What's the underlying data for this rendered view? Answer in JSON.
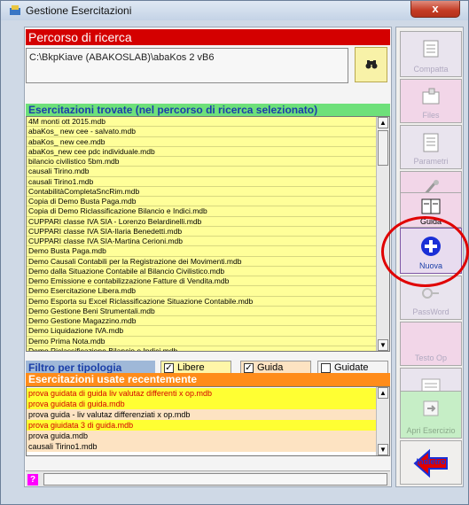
{
  "window": {
    "title": "Gestione Esercitazioni",
    "close_label": "x"
  },
  "search": {
    "header": "Percorso di ricerca",
    "path": "C:\\BkpKiave (ABAKOSLAB)\\abaKos 2 vB6"
  },
  "found": {
    "header": "Esercitazioni trovate (nel percorso di ricerca selezionato)",
    "items": [
      "4M monti ott 2015.mdb",
      "abaKos_ new cee - salvato.mdb",
      "abaKos_ new cee.mdb",
      "abaKos_new cee pdc individuale.mdb",
      "bilancio civilistico 5bm.mdb",
      "causali Tirino.mdb",
      "causali Tirino1.mdb",
      "ContabilitàCompletaSncRim.mdb",
      "Copia di Demo Busta Paga.mdb",
      "Copia di Demo Riclassificazione Bilancio e Indici.mdb",
      "CUPPARI classe IVA SIA - Lorenzo Belardinelli.mdb",
      "CUPPARI classe IVA SIA-Ilaria Benedetti.mdb",
      "CUPPARI classe IVA SIA-Martina Cerioni.mdb",
      "Demo Busta Paga.mdb",
      "Demo Causali Contabili per la Registrazione dei Movimenti.mdb",
      "Demo dalla Situazione Contabile al Bilancio Civilistico.mdb",
      "Demo Emissione e contabilizzazione Fatture di Vendita.mdb",
      "Demo Esercitazione Libera.mdb",
      "Demo Esporta su Excel Riclassificazione Situazione Contabile.mdb",
      "Demo Gestione Beni Strumentali.mdb",
      "Demo Gestione Magazzino.mdb",
      "Demo Liquidazione IVA.mdb",
      "Demo Prima Nota.mdb",
      "Demo Riclassificazione Bilancio e Indici.mdb"
    ]
  },
  "filter": {
    "label": "Filtro per tipologia",
    "options": [
      {
        "label": "Libere",
        "checked": true,
        "color": "#fff6a8"
      },
      {
        "label": "Guida",
        "checked": true,
        "color": "#fde3c2"
      },
      {
        "label": "Guidate",
        "checked": false,
        "color": "#f4f4f4"
      }
    ]
  },
  "recent": {
    "header": "Esercitazioni usate recentemente",
    "items": [
      {
        "label": "prova guidata di guida liv valutaz differenti x op.mdb",
        "style": "y"
      },
      {
        "label": "prova guidata di guida.mdb",
        "style": "y"
      },
      {
        "label": "prova guida - liv valutaz differenziati x op.mdb",
        "style": "b"
      },
      {
        "label": "prova giuidata 3 di guida.mdb",
        "style": "y"
      },
      {
        "label": "prova guida.mdb",
        "style": "b"
      },
      {
        "label": "causali Tirino1.mdb",
        "style": "b"
      }
    ]
  },
  "status": {
    "help_label": "?"
  },
  "toolbar": {
    "buttons": [
      {
        "label": "Compatta",
        "icon": "compact-icon",
        "enabled": false
      },
      {
        "label": "Files",
        "icon": "files-icon",
        "enabled": false
      },
      {
        "label": "Parametri",
        "icon": "params-icon",
        "enabled": false
      },
      {
        "label": "Azzera",
        "icon": "reset-icon",
        "enabled": false
      },
      {
        "label": "Guida",
        "icon": "book-icon",
        "enabled": true
      },
      {
        "label": "Nuova",
        "icon": "plus-icon",
        "enabled": true
      },
      {
        "label": "PassWord",
        "icon": "key-icon",
        "enabled": false
      },
      {
        "label": "Testo Op",
        "icon": "text-icon",
        "enabled": false
      },
      {
        "label": "Anagrafica",
        "icon": "registry-icon",
        "enabled": false
      },
      {
        "label": "Apri Esercizio",
        "icon": "open-icon",
        "enabled": false
      },
      {
        "label": "Indietro",
        "icon": "back-arrow-icon",
        "enabled": true
      }
    ]
  },
  "colors": {
    "accent_red": "#d40000",
    "green_header": "#6ee07a",
    "orange_header": "#ff8c1a",
    "list_bg": "#ffff99",
    "highlight_circle": "#e00000"
  }
}
